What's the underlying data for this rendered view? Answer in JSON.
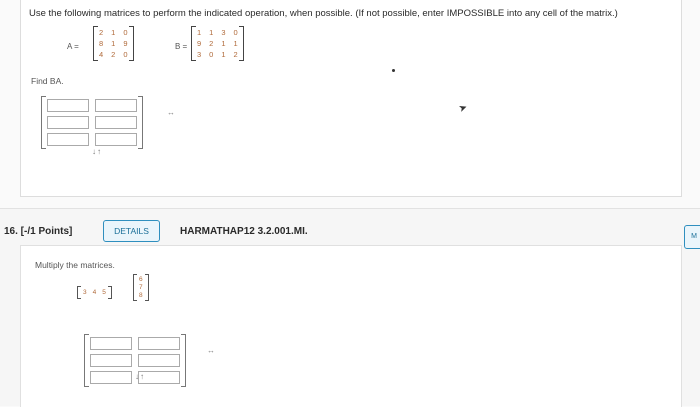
{
  "q15": {
    "instruction": "Use the following matrices to perform the indicated operation, when possible. (If not possible, enter IMPOSSIBLE into any cell of the matrix.)",
    "matrixA": {
      "label": "A =",
      "rows": [
        [
          "2",
          "1",
          "0"
        ],
        [
          "8",
          "1",
          "9"
        ],
        [
          "4",
          "2",
          "0"
        ]
      ]
    },
    "matrixB": {
      "label": "B =",
      "rows": [
        [
          "1",
          "1",
          "3",
          "0"
        ],
        [
          "9",
          "2",
          "1",
          "1"
        ],
        [
          "3",
          "0",
          "1",
          "2"
        ]
      ]
    },
    "find": "Find BA.",
    "answer_icons": "↔",
    "arrows": "↓↑"
  },
  "q16": {
    "number": "16. [-/1 Points]",
    "details_label": "DETAILS",
    "code": "HARMATHAP12 3.2.001.MI.",
    "side_tab": "M",
    "instruction": "Multiply the matrices.",
    "row_vector": [
      "3",
      "4",
      "5"
    ],
    "col_vector": [
      "6",
      "7",
      "8"
    ],
    "answer_icons": "↔",
    "arrows": "↓↑"
  }
}
